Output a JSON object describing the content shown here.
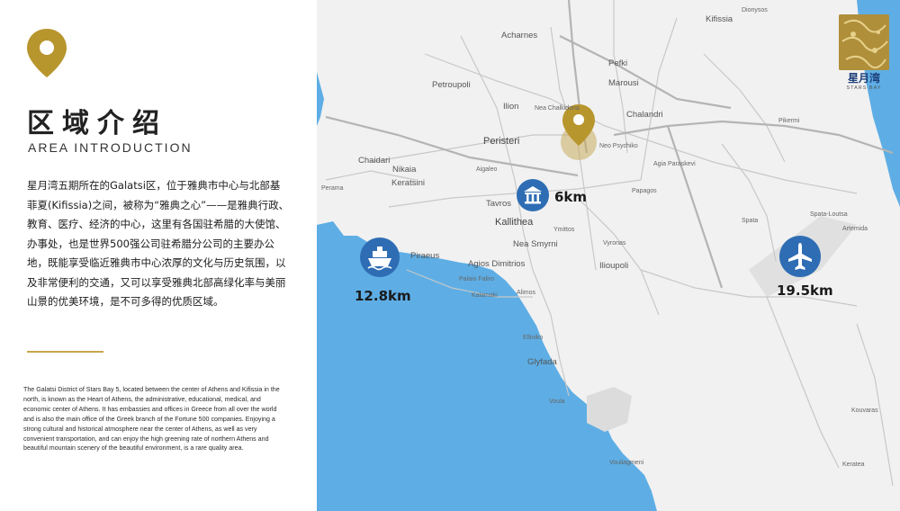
{
  "left_panel": {
    "title_cn": "区域介绍",
    "title_en": "AREA INTRODUCTION",
    "cn_paragraph": "星月湾五期所在的Galatsi区，位于雅典市中心与北部基菲夏(Kifissia)之间，被称为“雅典之心”——是雅典行政、教育、医疗、经济的中心，这里有各国驻希腊的大使馆、办事处，也是世界500强公司驻希腊分公司的主要办公地，既能享受临近雅典市中心浓厚的文化与历史氛围，以及非常便利的交通，又可以享受雅典北部高绿化率与美丽山景的优美环境，是不可多得的优质区域。",
    "en_paragraph": "The Galatsi District of Stars Bay 5, located between the center of Athens and Kifissia in the north, is known as the Heart of Athens, the administrative, educational, medical, and economic center of Athens. It has embassies and offices in Greece from all over the world and is also the main office of the Greek branch of the Fortune 500 companies. Enjoying a strong cultural and historical atmosphere near the center of Athens, as well as very convenient transportation, and can enjoy the high greening rate of northern Athens and beautiful mountain scenery of the beautiful environment, is a rare quality area.",
    "accent_color": "#c9a64a"
  },
  "logo": {
    "name_cn": "星月湾",
    "name_en": "STARS BAY"
  },
  "map": {
    "places": [
      {
        "name": "Dionysos"
      },
      {
        "name": "Kifissia"
      },
      {
        "name": "Acharnes"
      },
      {
        "name": "Pefki"
      },
      {
        "name": "Marousi"
      },
      {
        "name": "Petroupoli"
      },
      {
        "name": "Ilion"
      },
      {
        "name": "Nea Chalkidona"
      },
      {
        "name": "Chalandri"
      },
      {
        "name": "Pikermi"
      },
      {
        "name": "Peristeri"
      },
      {
        "name": "Neo Psychiko"
      },
      {
        "name": "Chaidari"
      },
      {
        "name": "Agia Paraskevi"
      },
      {
        "name": "Nikaia"
      },
      {
        "name": "Aigaleo"
      },
      {
        "name": "Keratsini"
      },
      {
        "name": "Papagos"
      },
      {
        "name": "Perama"
      },
      {
        "name": "Tavros"
      },
      {
        "name": "Spata"
      },
      {
        "name": "Spata-Loutsa"
      },
      {
        "name": "Kallithea"
      },
      {
        "name": "Artemida"
      },
      {
        "name": "Ymittos"
      },
      {
        "name": "Nea Smyrni"
      },
      {
        "name": "Vyronas"
      },
      {
        "name": "Piraeus"
      },
      {
        "name": "Agios Dimitrios"
      },
      {
        "name": "Ilioupoli"
      },
      {
        "name": "Palaio Faliro"
      },
      {
        "name": "Kalamaki"
      },
      {
        "name": "Alimos"
      },
      {
        "name": "Elliniko"
      },
      {
        "name": "Glyfada"
      },
      {
        "name": "Voula"
      },
      {
        "name": "Kouvaras"
      },
      {
        "name": "Vouliagmeni"
      },
      {
        "name": "Keratea"
      }
    ],
    "markers": {
      "center": {
        "distance": "6km",
        "icon": "landmark-icon"
      },
      "port": {
        "distance": "12.8km",
        "icon": "ship-icon"
      },
      "airport": {
        "distance": "19.5km",
        "icon": "airplane-icon"
      },
      "project": {
        "icon": "location-pin-icon"
      }
    },
    "colors": {
      "sea": "#5eaee5",
      "land": "#f1f1f1",
      "marker_blue": "#2e6db4",
      "pin_gold": "#b8962e"
    }
  }
}
